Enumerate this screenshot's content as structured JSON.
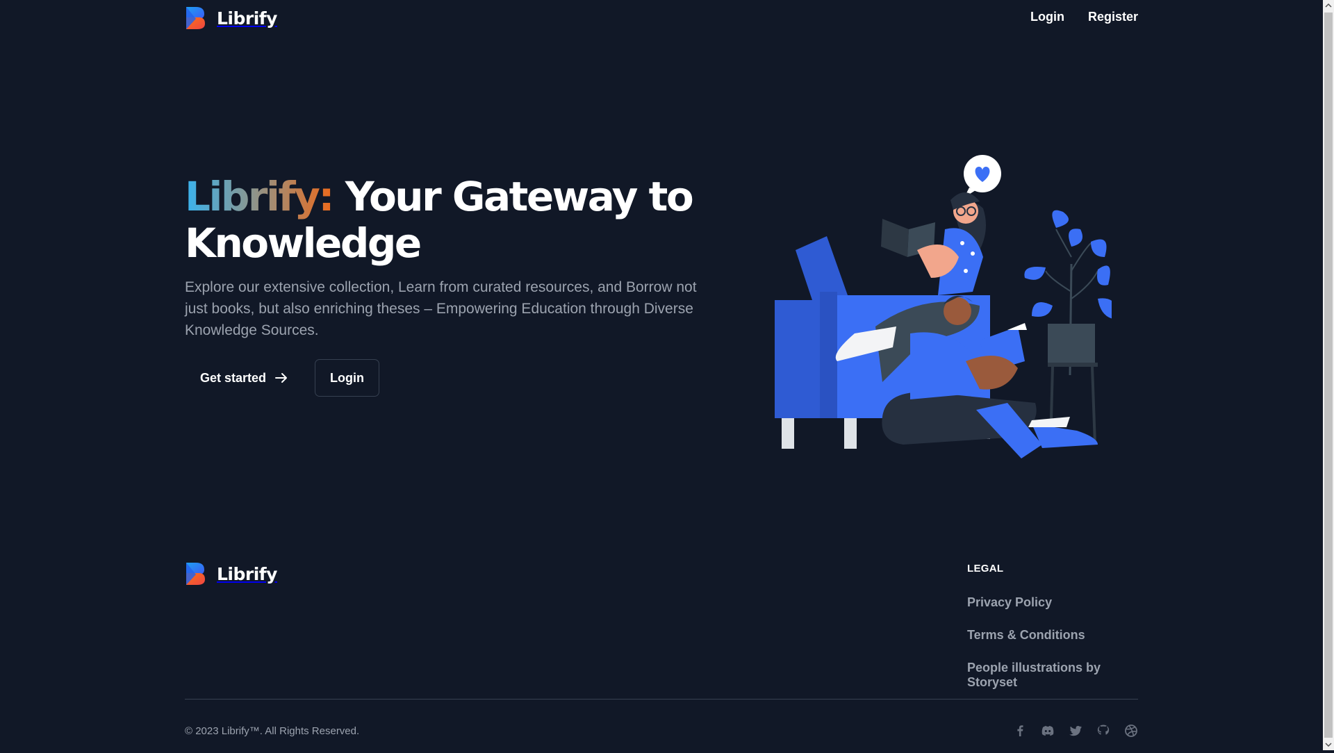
{
  "header": {
    "brand_name": "Librify",
    "nav": [
      {
        "label": "Login"
      },
      {
        "label": "Register"
      }
    ]
  },
  "hero": {
    "title_highlight": "Librify:",
    "title_rest": " Your Gateway to Knowledge",
    "description": "Explore our extensive collection, Learn from curated resources, and Borrow not just books, but also enriching theses – Empowering Education through Diverse Knowledge Sources.",
    "get_started_label": "Get started",
    "login_label": "Login"
  },
  "footer": {
    "brand_name": "Librify",
    "legal_title": "LEGAL",
    "legal_links": [
      {
        "label": "Privacy Policy"
      },
      {
        "label": "Terms & Conditions"
      },
      {
        "label": "People illustrations by Storyset"
      }
    ],
    "copyright": "© 2023 Librify™. All Rights Reserved.",
    "social_icons": [
      "facebook-icon",
      "discord-icon",
      "twitter-icon",
      "github-icon",
      "dribbble-icon"
    ]
  },
  "colors": {
    "background": "#111827",
    "text_muted": "#9ca3af",
    "divider": "#374151",
    "accent_blue": "#3b6ff5",
    "gradient_start": "#39b3ee",
    "gradient_end": "#ec6a1c"
  },
  "icons": {
    "logo": "librify-logo-icon",
    "arrow": "arrow-right-icon"
  }
}
